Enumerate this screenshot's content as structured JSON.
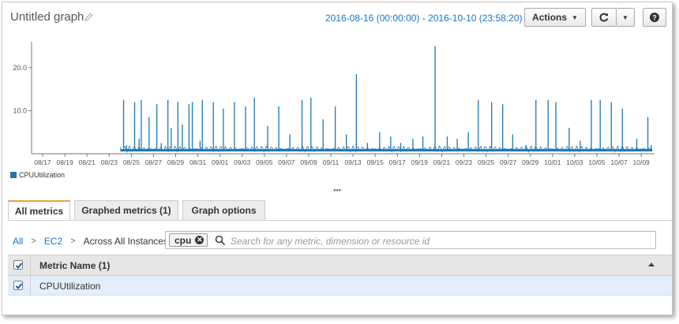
{
  "header": {
    "title": "Untitled graph",
    "date_range": "2016-08-16 (00:00:00) - 2016-10-10 (23:58:20)",
    "actions_label": "Actions"
  },
  "chart_data": {
    "type": "line",
    "x_tick_labels": [
      "08/17",
      "08/19",
      "08/21",
      "08/23",
      "08/25",
      "08/27",
      "08/29",
      "08/31",
      "09/01",
      "09/03",
      "09/05",
      "09/07",
      "09/09",
      "09/11",
      "09/13",
      "09/15",
      "09/17",
      "09/19",
      "09/21",
      "09/23",
      "09/25",
      "09/27",
      "09/29",
      "10/01",
      "10/03",
      "10/05",
      "10/07",
      "10/09"
    ],
    "y_tick_labels": [
      "10.0",
      "20.0"
    ],
    "ylim": [
      0,
      26
    ],
    "series": [
      {
        "name": "CPUUtilization",
        "color": "#1f77b4",
        "baseline": 0.8,
        "x": [
          8.3,
          8.55,
          9.3,
          9.7,
          9.9,
          10.6,
          11.3,
          11.7,
          12.3,
          12.6,
          13.2,
          13.6,
          14.2,
          14.5,
          15.2,
          15.4,
          16.4,
          17.3,
          18.3,
          19.3,
          20.1,
          21.3,
          22.3,
          23.3,
          24.4,
          25.2,
          26.3,
          27.4,
          28.4,
          29.3,
          30.3,
          31.4,
          32.4,
          33.3,
          34.4,
          35.3,
          36.4,
          37.5,
          38.4,
          39.4,
          40.3,
          41.5,
          42.5,
          43.4,
          44.6,
          45.5,
          46.6,
          47.3,
          48.5,
          49.5,
          50.5,
          51.3,
          52.3,
          53.3,
          54.6,
          55.6,
          55.9
        ],
        "values": [
          12.5,
          2.0,
          12.0,
          3.5,
          12.5,
          8.5,
          11.5,
          2.5,
          12.5,
          6.0,
          12.0,
          6.8,
          11.5,
          12.0,
          3.0,
          12.5,
          12.0,
          10.5,
          12.0,
          11.0,
          13.0,
          6.5,
          11.0,
          4.5,
          12.5,
          13.0,
          8.0,
          11.0,
          4.5,
          18.5,
          2.5,
          5.0,
          4.0,
          2.5,
          3.5,
          4.0,
          25.0,
          4.0,
          3.5,
          5.0,
          12.5,
          12.0,
          11.5,
          4.5,
          2.0,
          12.5,
          12.5,
          12.0,
          6.0,
          3.0,
          12.5,
          12.5,
          12.0,
          10.5,
          3.5,
          8.5,
          2.0
        ]
      }
    ]
  },
  "legend": {
    "label": "CPUUtilization"
  },
  "splitter_label": "▪▪▪",
  "tabs": [
    {
      "label": "All metrics",
      "active": true
    },
    {
      "label": "Graphed metrics (1)",
      "active": false
    },
    {
      "label": "Graph options",
      "active": false
    }
  ],
  "breadcrumbs": {
    "all": "All",
    "sep": ">",
    "ec2": "EC2",
    "across": "Across All Instances"
  },
  "search": {
    "token": "cpu",
    "placeholder": "Search for any metric, dimension or resource id"
  },
  "table": {
    "header_label": "Metric Name  (1)",
    "rows": [
      {
        "name": "CPUUtilization",
        "checked": true
      }
    ]
  }
}
